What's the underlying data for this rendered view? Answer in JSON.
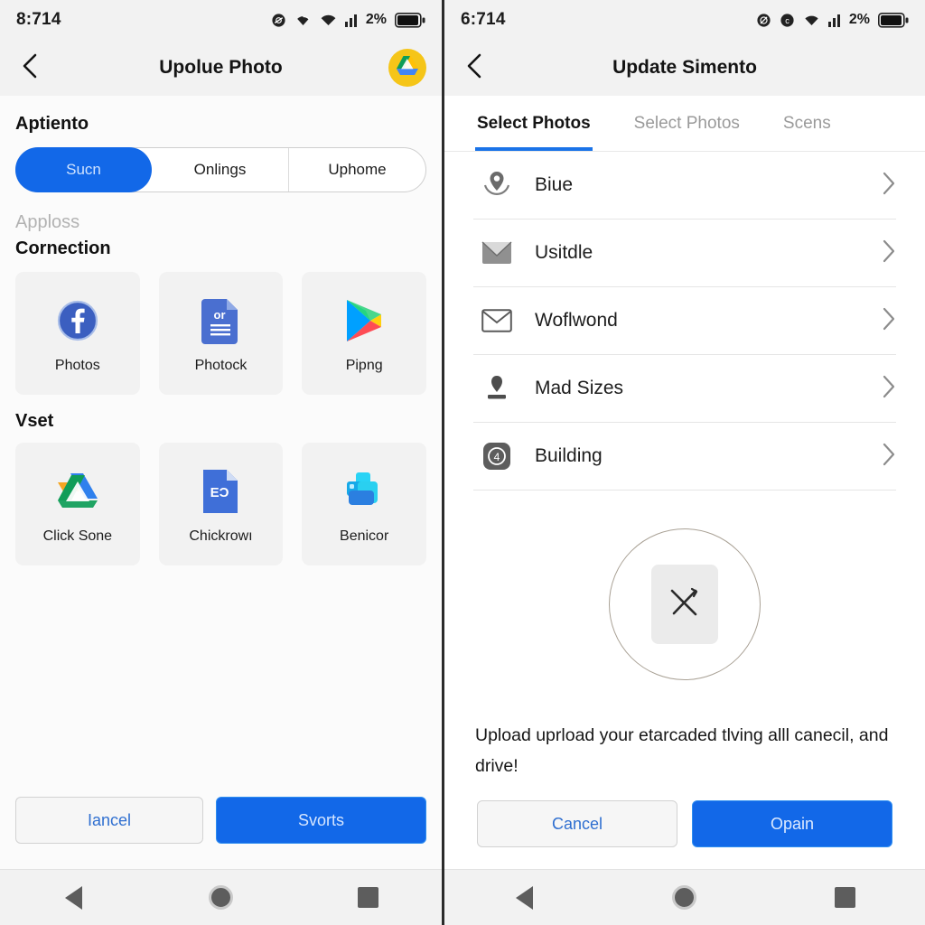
{
  "left": {
    "status": {
      "time": "8:714",
      "battery": "2%"
    },
    "appbar": {
      "title": "Upolue Photo",
      "back_icon": "chevron-left-icon",
      "avatar_icon": "google-drive-logo"
    },
    "section_account": "Aptiento",
    "segments": [
      {
        "label": "Sucn",
        "active": true
      },
      {
        "label": "Onlings",
        "active": false
      },
      {
        "label": "Uphome",
        "active": false
      }
    ],
    "section_apploss": "Apploss",
    "section_connection": "Cornection",
    "connection_tiles": [
      {
        "label": "Photos",
        "icon": "facebook-icon"
      },
      {
        "label": "Photock",
        "icon": "google-docs-icon"
      },
      {
        "label": "Pipng",
        "icon": "google-play-icon"
      }
    ],
    "section_vset": "Vset",
    "vset_tiles": [
      {
        "label": "Click Sone",
        "icon": "google-drive-icon"
      },
      {
        "label": "Chickrowı",
        "icon": "google-docs-file-icon"
      },
      {
        "label": "Benicor",
        "icon": "blue-shape-icon"
      }
    ],
    "actions": {
      "cancel": "Iancel",
      "submit": "Svorts"
    }
  },
  "right": {
    "status": {
      "time": "6:714",
      "battery": "2%"
    },
    "appbar": {
      "title": "Update Simento",
      "back_icon": "chevron-left-icon"
    },
    "tabs": [
      {
        "label": "Select Photos",
        "active": true
      },
      {
        "label": "Select Photos",
        "active": false
      },
      {
        "label": "Scens",
        "active": false
      }
    ],
    "list_items": [
      {
        "label": "Biue",
        "icon": "location-pin-icon"
      },
      {
        "label": "Usitdle",
        "icon": "mail-filled-icon"
      },
      {
        "label": "Woflwond",
        "icon": "mail-outline-icon"
      },
      {
        "label": "Mad Sizes",
        "icon": "stamp-icon"
      },
      {
        "label": "Building",
        "icon": "app-badge-icon"
      }
    ],
    "empty": {
      "icon": "crossed-tools-icon",
      "text": "Upload uprload your etarcaded tlving alll canecil, and drive!"
    },
    "actions": {
      "cancel": "Cancel",
      "confirm": "Opain"
    }
  },
  "navbar": {
    "back": "nav-back-triangle",
    "home": "nav-home-circle",
    "recents": "nav-recents-square"
  },
  "colors": {
    "accent": "#1268e8",
    "tab_underline": "#1a73e8",
    "surface": "#f2f2f2"
  }
}
